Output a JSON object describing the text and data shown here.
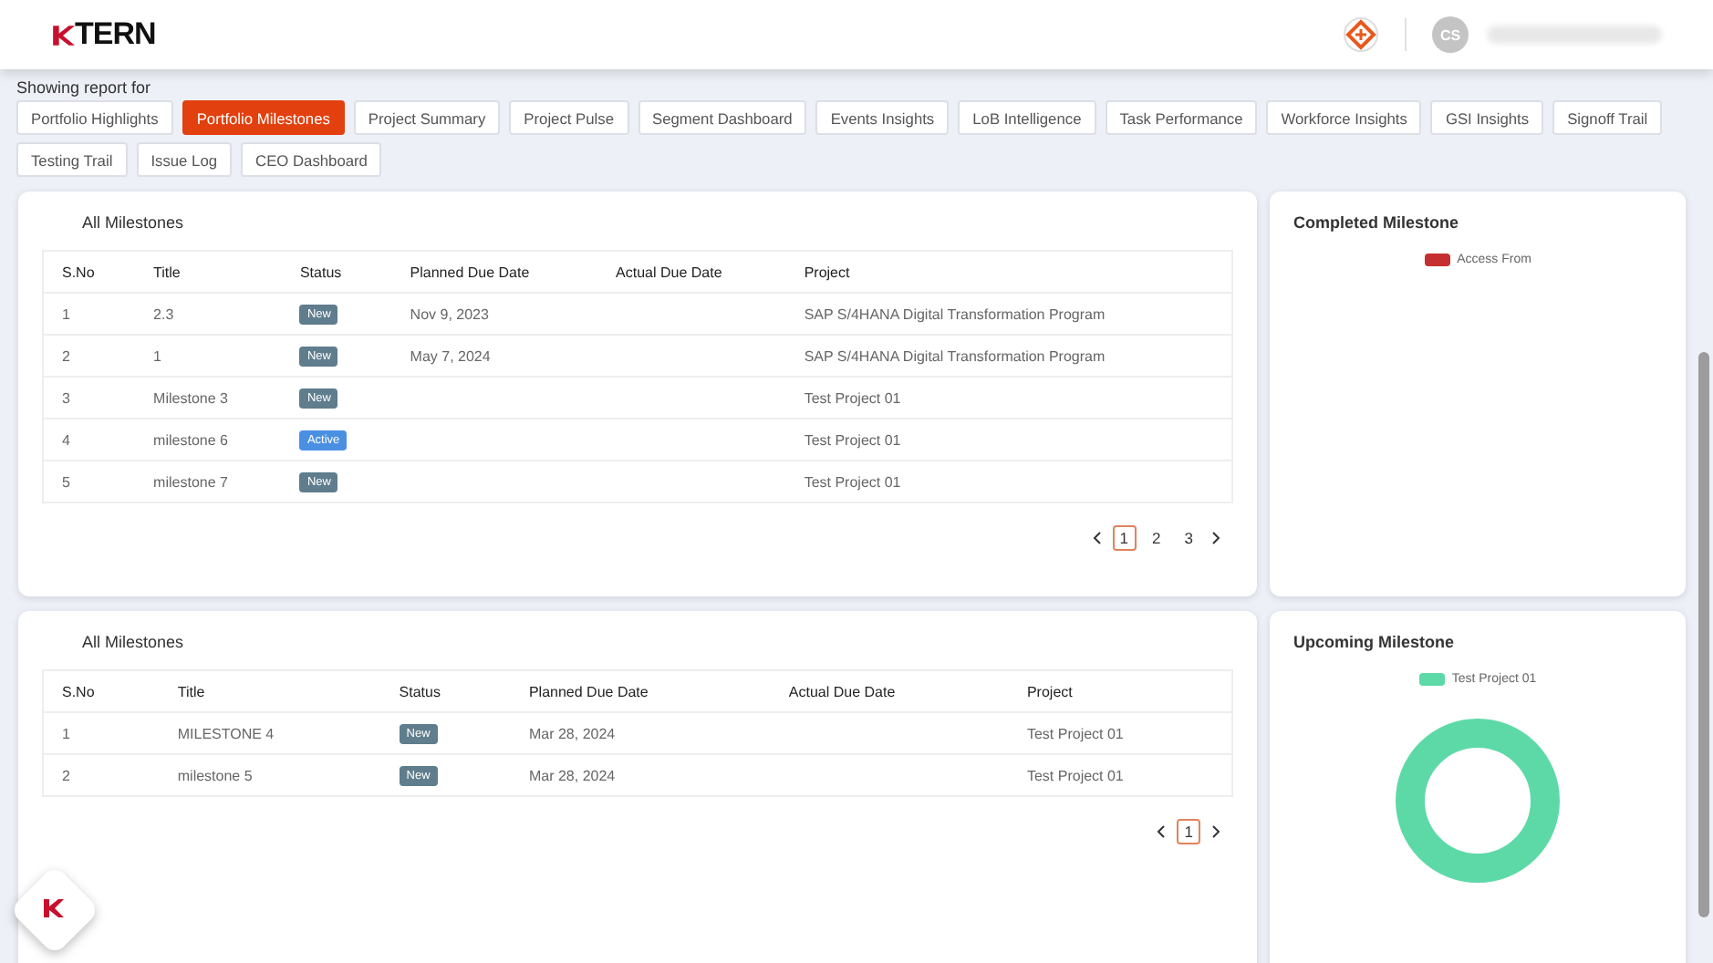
{
  "header": {
    "logo": "TERN",
    "avatar": "CS"
  },
  "report_filter": {
    "label": "Showing report for",
    "tabs": [
      {
        "label": "Portfolio Highlights",
        "selected": false
      },
      {
        "label": "Portfolio Milestones",
        "selected": true
      },
      {
        "label": "Project Summary",
        "selected": false
      },
      {
        "label": "Project Pulse",
        "selected": false
      },
      {
        "label": "Segment Dashboard",
        "selected": false
      },
      {
        "label": "Events Insights",
        "selected": false
      },
      {
        "label": "LoB Intelligence",
        "selected": false
      },
      {
        "label": "Task Performance",
        "selected": false
      },
      {
        "label": "Workforce Insights",
        "selected": false
      },
      {
        "label": "GSI Insights",
        "selected": false
      },
      {
        "label": "Signoff Trail",
        "selected": false
      },
      {
        "label": "Testing Trail",
        "selected": false
      },
      {
        "label": "Issue Log",
        "selected": false
      },
      {
        "label": "CEO Dashboard",
        "selected": false
      }
    ]
  },
  "sections": [
    {
      "table": {
        "title": "All Milestones",
        "columns": [
          "S.No",
          "Title",
          "Status",
          "Planned Due Date",
          "Actual Due Date",
          "Project"
        ],
        "rows": [
          {
            "sno": "1",
            "title": "2.3",
            "status": {
              "label": "New",
              "kind": "new"
            },
            "planned": "Nov 9, 2023",
            "actual": "",
            "project": "SAP S/4HANA Digital Transformation Program"
          },
          {
            "sno": "2",
            "title": "1",
            "status": {
              "label": "New",
              "kind": "new"
            },
            "planned": "May 7, 2024",
            "actual": "",
            "project": "SAP S/4HANA Digital Transformation Program"
          },
          {
            "sno": "3",
            "title": "Milestone 3",
            "status": {
              "label": "New",
              "kind": "new"
            },
            "planned": "",
            "actual": "",
            "project": "Test Project 01"
          },
          {
            "sno": "4",
            "title": "milestone 6",
            "status": {
              "label": "Active",
              "kind": "active"
            },
            "planned": "",
            "actual": "",
            "project": "Test Project 01"
          },
          {
            "sno": "5",
            "title": "milestone 7",
            "status": {
              "label": "New",
              "kind": "new"
            },
            "planned": "",
            "actual": "",
            "project": "Test Project 01"
          }
        ],
        "pages": [
          {
            "label": "1",
            "selected": true
          },
          {
            "label": "2",
            "selected": false
          },
          {
            "label": "3",
            "selected": false
          }
        ]
      },
      "chart": {
        "title": "Completed Milestone",
        "kind": "empty",
        "legend": [
          {
            "label": "Access From",
            "color": "#c62f2f"
          }
        ]
      }
    },
    {
      "table": {
        "title": "All Milestones",
        "columns": [
          "S.No",
          "Title",
          "Status",
          "Planned Due Date",
          "Actual Due Date",
          "Project"
        ],
        "rows": [
          {
            "sno": "1",
            "title": "MILESTONE 4",
            "status": {
              "label": "New",
              "kind": "new"
            },
            "planned": "Mar 28, 2024",
            "actual": "",
            "project": "Test Project 01"
          },
          {
            "sno": "2",
            "title": "milestone 5",
            "status": {
              "label": "New",
              "kind": "new"
            },
            "planned": "Mar 28, 2024",
            "actual": "",
            "project": "Test Project 01"
          }
        ],
        "pages": [
          {
            "label": "1",
            "selected": true
          }
        ]
      },
      "chart": {
        "title": "Upcoming Milestone",
        "kind": "donut",
        "legend": [
          {
            "label": "Test Project 01",
            "color": "#5dd9a8"
          }
        ]
      }
    }
  ]
}
